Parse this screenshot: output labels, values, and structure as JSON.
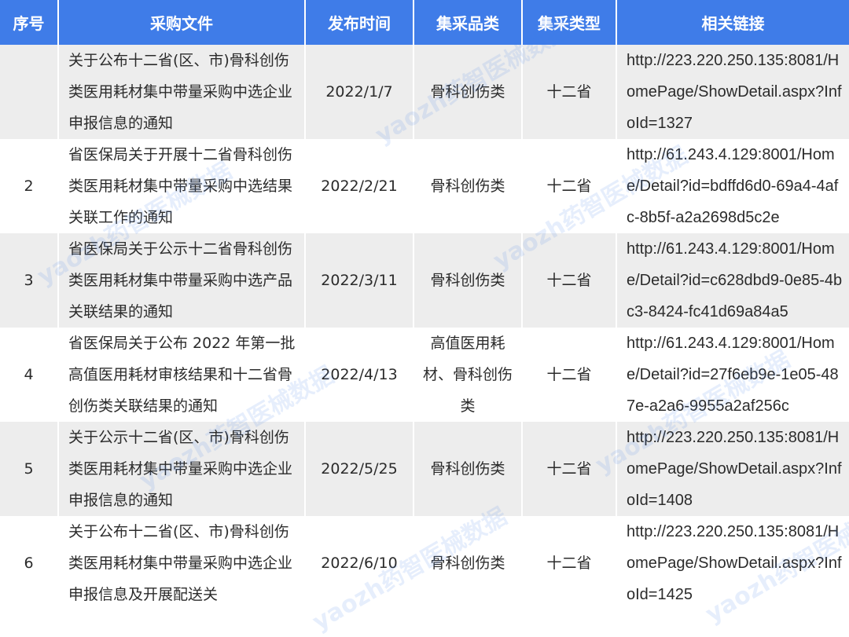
{
  "headers": [
    "序号",
    "采购文件",
    "发布时间",
    "集采品类",
    "集采类型",
    "相关链接"
  ],
  "rows": [
    {
      "seq": "",
      "doc": "关于公布十二省(区、市)骨科创伤类医用耗材集中带量采购中选企业申报信息的通知",
      "date": "2022/1/7",
      "category": "骨科创伤类",
      "type": "十二省",
      "link": "http://223.220.250.135:8081/HomePage/ShowDetail.aspx?InfoId=1327"
    },
    {
      "seq": "2",
      "doc": "省医保局关于开展十二省骨科创伤类医用耗材集中带量采购中选结果关联工作的通知",
      "date": "2022/2/21",
      "category": "骨科创伤类",
      "type": "十二省",
      "link": "http://61.243.4.129:8001/Home/Detail?id=bdffd6d0-69a4-4afc-8b5f-a2a2698d5c2e"
    },
    {
      "seq": "3",
      "doc": "省医保局关于公示十二省骨科创伤类医用耗材集中带量采购中选产品关联结果的通知",
      "date": "2022/3/11",
      "category": "骨科创伤类",
      "type": "十二省",
      "link": "http://61.243.4.129:8001/Home/Detail?id=c628dbd9-0e85-4bc3-8424-fc41d69a84a5"
    },
    {
      "seq": "4",
      "doc": "省医保局关于公布 2022 年第一批高值医用耗材审核结果和十二省骨创伤类关联结果的通知",
      "date": "2022/4/13",
      "category": "高值医用耗材、骨科创伤类",
      "type": "十二省",
      "link": "http://61.243.4.129:8001/Home/Detail?id=27f6eb9e-1e05-487e-a2a6-9955a2af256c"
    },
    {
      "seq": "5",
      "doc": "关于公示十二省(区、市)骨科创伤类医用耗材集中带量采购中选企业申报信息的通知",
      "date": "2022/5/25",
      "category": "骨科创伤类",
      "type": "十二省",
      "link": "http://223.220.250.135:8081/HomePage/ShowDetail.aspx?InfoId=1408"
    },
    {
      "seq": "6",
      "doc": "关于公布十二省(区、市)骨科创伤类医用耗材集中带量采购中选企业申报信息及开展配送关",
      "date": "2022/6/10",
      "category": "骨科创伤类",
      "type": "十二省",
      "link": "http://223.220.250.135:8081/HomePage/ShowDetail.aspx?InfoId=1425"
    }
  ],
  "watermark": "yaozh药智医械数据",
  "colors": {
    "header_bg": "#3f7ce8",
    "shade_row": "#ededed",
    "text": "#2b2b2b"
  }
}
